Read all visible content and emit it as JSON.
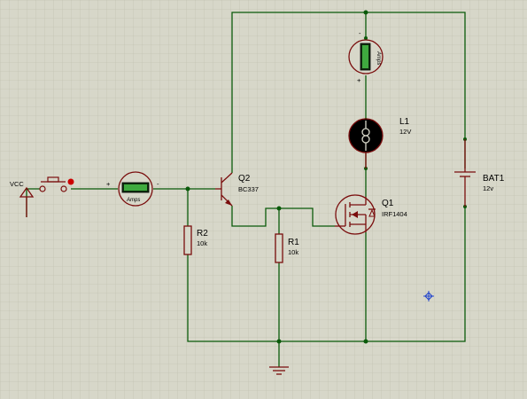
{
  "power": {
    "vcc_label": "VCC"
  },
  "ammeter_main": {
    "unit": "Amps",
    "plus": "+",
    "minus": "-"
  },
  "ammeter_top": {
    "unit": "Amps",
    "plus": "+",
    "minus": "-"
  },
  "transistor_q2": {
    "ref": "Q2",
    "part": "BC337"
  },
  "mosfet_q1": {
    "ref": "Q1",
    "part": "IRF1404"
  },
  "resistor_r1": {
    "ref": "R1",
    "value": "10k"
  },
  "resistor_r2": {
    "ref": "R2",
    "value": "10k"
  },
  "lamp_l1": {
    "ref": "L1",
    "value": "12V"
  },
  "battery_bat1": {
    "ref": "BAT1",
    "value": "12v"
  },
  "colors": {
    "background": "#d7d7c9",
    "grid": "#c3c3b3",
    "wire": "#0a5a0a",
    "component": "#7a0d0d",
    "meter_display": "#3faa3f"
  }
}
